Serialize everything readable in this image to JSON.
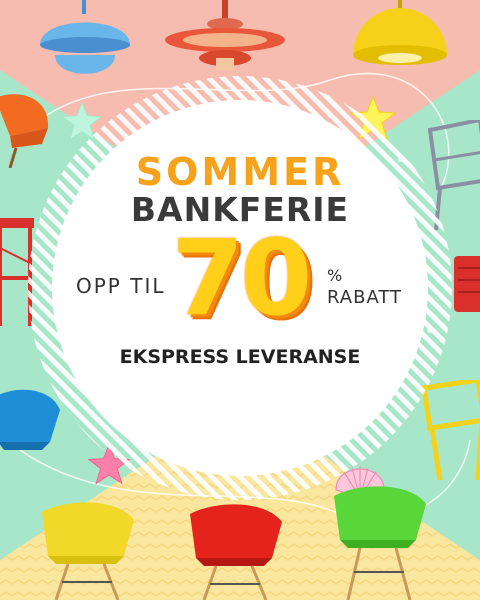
{
  "banner": {
    "title_line1": "SOMMER",
    "title_line2": "BANKFERIE",
    "prefix": "OPP TIL",
    "discount": "70",
    "percent_sign": "%",
    "suffix": "RABATT",
    "tagline": "EKSPRESS LEVERANSE"
  },
  "colors": {
    "bg_top": "#f7bcb0",
    "bg_mint": "#a8e6c9",
    "bg_bottom": "#f9e7a0",
    "accent_orange": "#f7a21b",
    "accent_yellow": "#ffcf1a",
    "title_dark": "#3a3a3a"
  },
  "icons": [
    "pendant-lamp-blue-icon",
    "pendant-lamp-red-icon",
    "pendant-lamp-yellow-icon",
    "star-icon",
    "shell-icon",
    "chair-icon"
  ]
}
